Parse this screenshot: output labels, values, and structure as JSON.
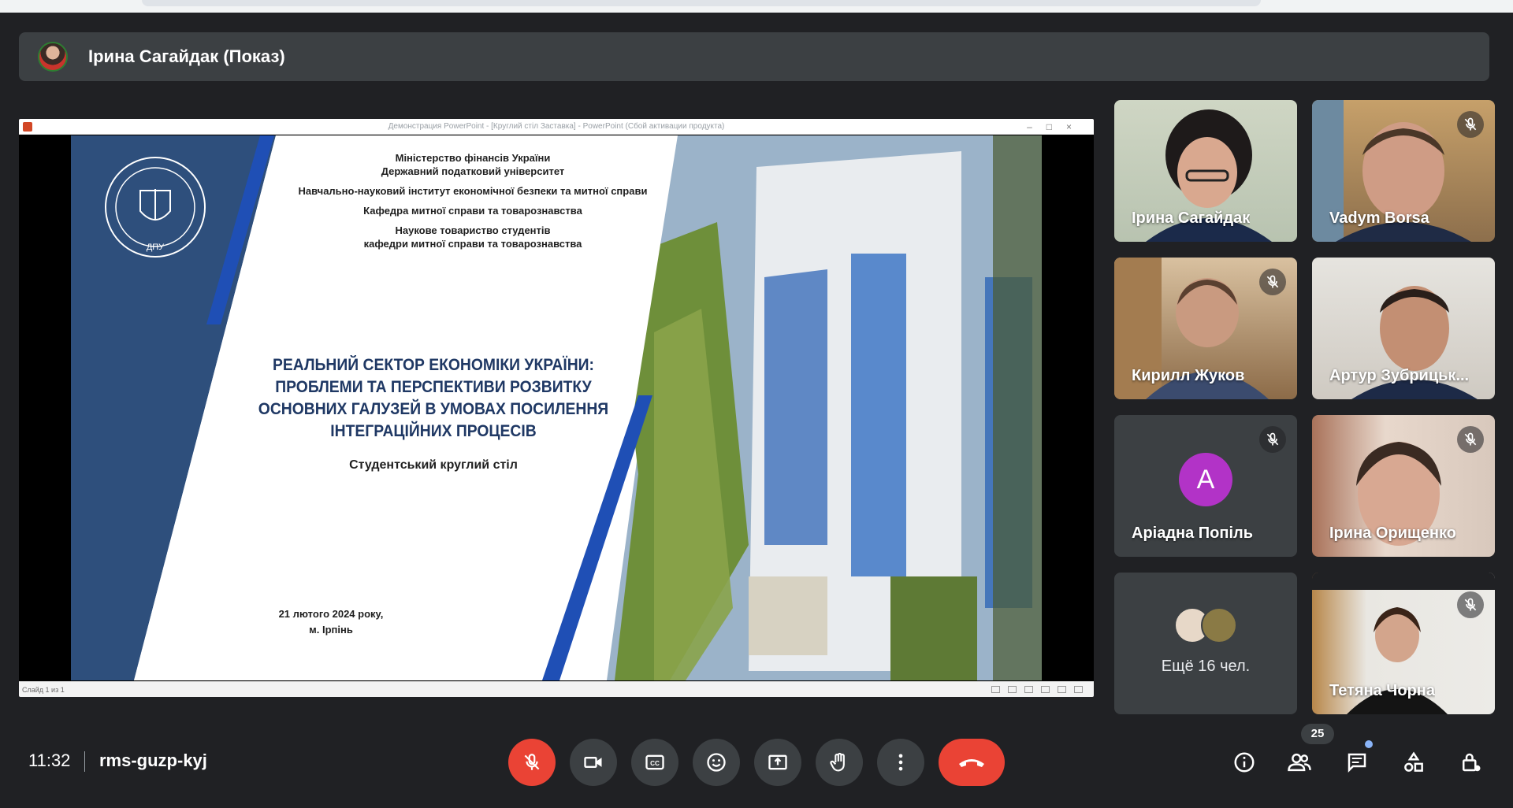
{
  "presenter": {
    "name": "Ірина Сагайдак (Показ)"
  },
  "ppt": {
    "window_title": "Демонстрация PowerPoint - [Круглий стіл Заставка] - PowerPoint (Сбой активации продукта)",
    "status": "Слайд 1 из 1",
    "window_controls": "–□×"
  },
  "slide": {
    "header_lines": [
      "Міністерство фінансів України",
      "Державний податковий університет",
      "Навчально-науковий інститут економічної безпеки та митної справи",
      "Кафедра митної справи та товарознавства",
      "Наукове товариство студентів",
      "кафедри митної справи та товарознавства"
    ],
    "title": "РЕАЛЬНИЙ СЕКТОР ЕКОНОМІКИ УКРАЇНИ: ПРОБЛЕМИ ТА ПЕРСПЕКТИВИ РОЗВИТКУ ОСНОВНИХ ГАЛУЗЕЙ В УМОВАХ ПОСИЛЕННЯ ІНТЕГРАЦІЙНИХ ПРОЦЕСІВ",
    "subtitle": "Студентський круглий стіл",
    "date": "21 лютого  2024 року,",
    "place": "м. Ірпінь",
    "seal_text": "ДПУ"
  },
  "participants": [
    {
      "name": "Ірина Сагайдак",
      "muted": false
    },
    {
      "name": "Vadym Borsa",
      "muted": true
    },
    {
      "name": "Кирилл Жуков",
      "muted": true
    },
    {
      "name": "Артур Зубрицьк...",
      "muted": false
    },
    {
      "name": "Аріадна Попіль",
      "muted": true,
      "initial": "A"
    },
    {
      "name": "Ірина Орищенко",
      "muted": true
    },
    {
      "name": "Тетяна Чорна",
      "muted": true
    }
  ],
  "more_participants": "Ещё 16 чел.",
  "bottom": {
    "time": "11:32",
    "meeting_code": "rms-guzp-kyj",
    "people_count": "25"
  },
  "icons": {
    "mic": "mic-off-icon",
    "camera": "videocam-icon",
    "captions": "closed-caption-icon",
    "emoji": "emoji-icon",
    "present": "present-screen-icon",
    "hand": "raise-hand-icon",
    "more": "more-vert-icon",
    "hangup": "call-end-icon",
    "info": "info-icon",
    "people": "people-icon",
    "chat": "chat-icon",
    "activities": "activities-icon",
    "host": "host-controls-icon"
  },
  "colors": {
    "hangup": "#ea4335",
    "background": "#202124",
    "tile": "#3c4043",
    "slide_blue": "#2e4f7c",
    "avatar_purple": "#b233c7"
  }
}
